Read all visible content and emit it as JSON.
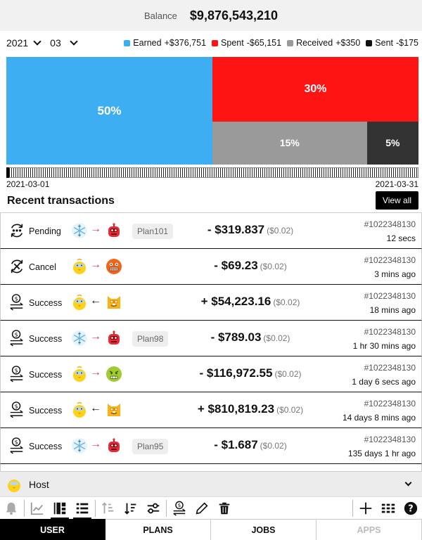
{
  "balance": {
    "label": "Balance",
    "value": "$9,876,543,210"
  },
  "filters": {
    "year": "2021",
    "month": "03"
  },
  "legend": [
    {
      "label": "Earned",
      "value": "+$376,751",
      "color": "#3daef2"
    },
    {
      "label": "Spent",
      "value": "-$65,151",
      "color": "#ff1414"
    },
    {
      "label": "Received",
      "value": "+$350",
      "color": "#9a9a9a"
    },
    {
      "label": "Sent",
      "value": "-$175",
      "color": "#111111"
    }
  ],
  "chart_data": {
    "type": "treemap",
    "categories": [
      "Earned",
      "Spent",
      "Received",
      "Sent"
    ],
    "values": [
      50,
      30,
      15,
      5
    ],
    "labels": [
      "50%",
      "30%",
      "15%",
      "5%"
    ],
    "colors": [
      "#3daef2",
      "#ff1414",
      "#9a9a9a",
      "#333333"
    ]
  },
  "range": {
    "start": "2021-03-01",
    "end": "2021-03-31"
  },
  "recent": {
    "title": "Recent transactions",
    "view_all": "View all"
  },
  "transactions": [
    {
      "status": "Pending",
      "status_icon": "pending-icon",
      "from": "snowflake",
      "direction": "out",
      "to": "robot",
      "plan": "Plan101",
      "amount": "- $319.837",
      "fee": "($0.02)",
      "id": "#1022348130",
      "time": "12 secs"
    },
    {
      "status": "Cancel",
      "status_icon": "cancel-icon",
      "from": "chick",
      "direction": "out",
      "to": "grimace",
      "plan": "",
      "amount": "- $69.23",
      "fee": "($0.02)",
      "id": "#1022348130",
      "time": "3 mins ago"
    },
    {
      "status": "Success",
      "status_icon": "success-icon",
      "from": "chick",
      "direction": "in",
      "to": "cat",
      "plan": "",
      "amount": "+ $54,223.16",
      "fee": "($0.02)",
      "id": "#1022348130",
      "time": "18 mins ago"
    },
    {
      "status": "Success",
      "status_icon": "success-icon",
      "from": "snowflake",
      "direction": "out",
      "to": "robot",
      "plan": "Plan98",
      "amount": "- $789.03",
      "fee": "($0.02)",
      "id": "#1022348130",
      "time": "1 hr 30 mins ago"
    },
    {
      "status": "Success",
      "status_icon": "success-icon",
      "from": "chick",
      "direction": "out",
      "to": "sick-face",
      "plan": "",
      "amount": "- $116,972.55",
      "fee": "($0.02)",
      "id": "#1022348130",
      "time": "1 day 6 secs ago"
    },
    {
      "status": "Success",
      "status_icon": "success-icon",
      "from": "chick",
      "direction": "in",
      "to": "cat",
      "plan": "",
      "amount": "+ $810,819.23",
      "fee": "($0.02)",
      "id": "#1022348130",
      "time": "14 days 8 mins ago"
    },
    {
      "status": "Success",
      "status_icon": "success-icon",
      "from": "snowflake",
      "direction": "out",
      "to": "robot",
      "plan": "Plan95",
      "amount": "- $1.687",
      "fee": "($0.02)",
      "id": "#1022348130",
      "time": "135 days 1 hr ago"
    },
    {
      "status": "",
      "status_icon": "",
      "from": "",
      "direction": "",
      "to": "",
      "plan": "",
      "amount": "",
      "fee": "",
      "id": "",
      "time": ""
    }
  ],
  "host": {
    "label": "Host",
    "avatar": "chick"
  },
  "tabs": [
    {
      "label": "USER",
      "state": "active"
    },
    {
      "label": "PLANS",
      "state": "normal"
    },
    {
      "label": "JOBS",
      "state": "normal"
    },
    {
      "label": "APPS",
      "state": "disabled"
    }
  ]
}
